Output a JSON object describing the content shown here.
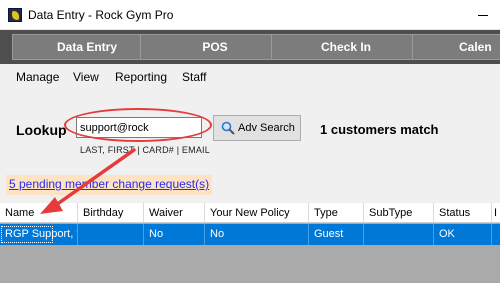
{
  "window": {
    "title": "Data Entry - Rock Gym Pro"
  },
  "nav": {
    "buttons": [
      "Data Entry",
      "POS",
      "Check In",
      "Calen"
    ]
  },
  "menu": {
    "items": [
      "Manage",
      "View",
      "Reporting",
      "Staff"
    ]
  },
  "lookup": {
    "label": "Lookup",
    "value": "support@rock",
    "hint": "LAST, FIRST | CARD# | EMAIL",
    "adv_search_label": "Adv Search",
    "match_text": "1 customers match"
  },
  "pending": {
    "link_text": "5 pending member change request(s)"
  },
  "grid": {
    "columns": [
      "Name",
      "Birthday",
      "Waiver",
      "Your New Policy",
      "Type",
      "SubType",
      "Status",
      "I"
    ],
    "rows": [
      [
        "RGP Support, *",
        "",
        "No",
        "No",
        "Guest",
        "",
        "OK",
        ""
      ]
    ]
  },
  "colors": {
    "title_bar": "#ffffff",
    "nav_band": "#4e4e4e",
    "nav_button": "#7c7c7c",
    "selection": "#0078d7",
    "callout": "#e53b3b",
    "link": "#2a2aee",
    "link_highlight": "#fde3c3"
  },
  "icons": {
    "app": "rock-gym-pro-logo-icon",
    "search": "magnifier-icon",
    "window_min": "minimize-icon"
  }
}
